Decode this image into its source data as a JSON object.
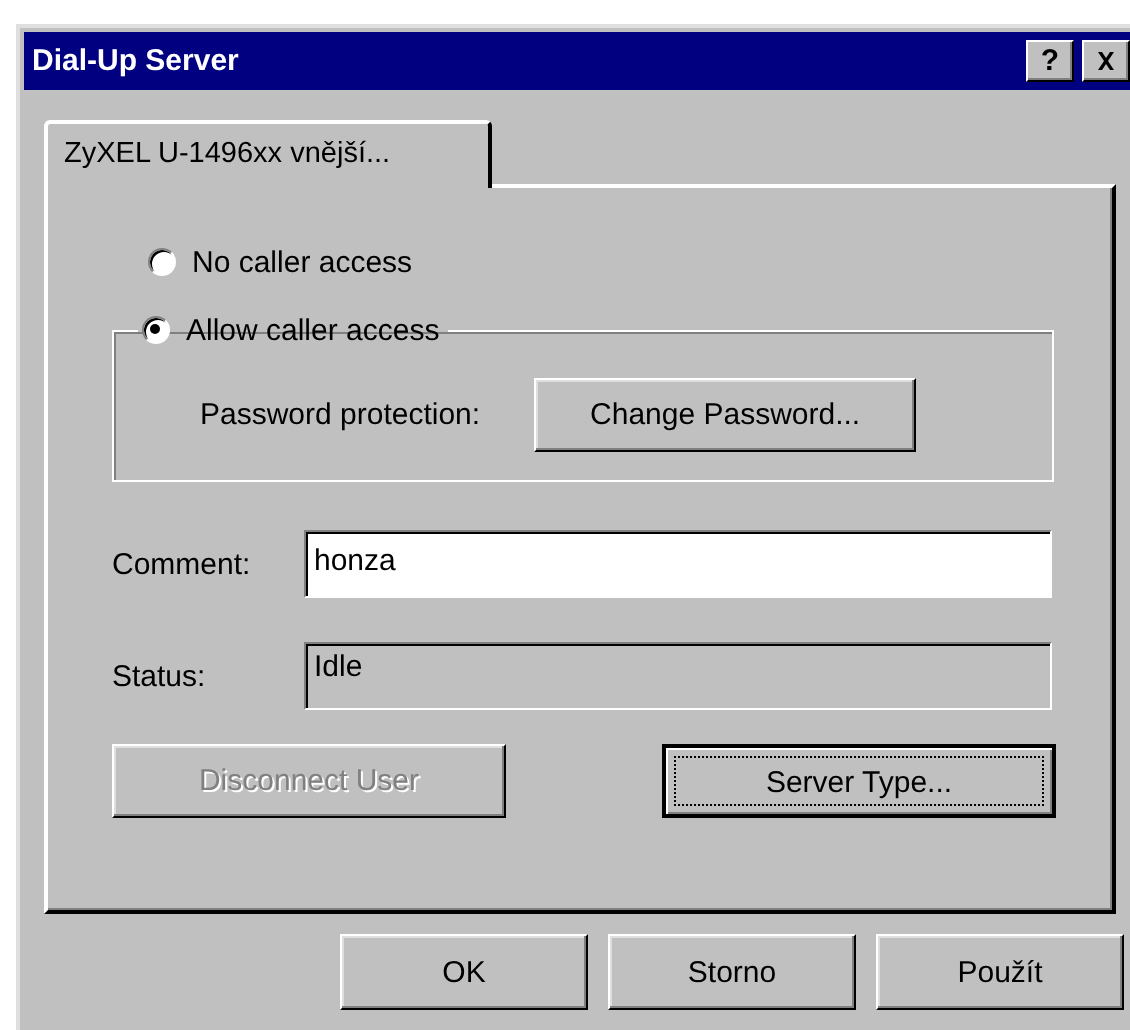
{
  "window": {
    "title": "Dial-Up Server",
    "help_button": "?"
  },
  "tabs": [
    {
      "label": "ZyXEL U-1496xx vnější...",
      "selected": true
    }
  ],
  "access_options": [
    {
      "label": "No caller access",
      "selected": false
    },
    {
      "label": "Allow caller access",
      "selected": true
    }
  ],
  "password": {
    "label": "Password protection:",
    "button": "Change Password..."
  },
  "fields": [
    {
      "label": "Comment:",
      "value": "honza",
      "editable": true
    },
    {
      "label": "Status:",
      "value": "Idle",
      "editable": false
    }
  ],
  "action_buttons": [
    {
      "label": "Disconnect User",
      "disabled": true,
      "focused": false
    },
    {
      "label": "Server Type...",
      "disabled": false,
      "focused": true
    }
  ],
  "dialog_buttons": [
    "OK",
    "Storno",
    "Použít"
  ]
}
